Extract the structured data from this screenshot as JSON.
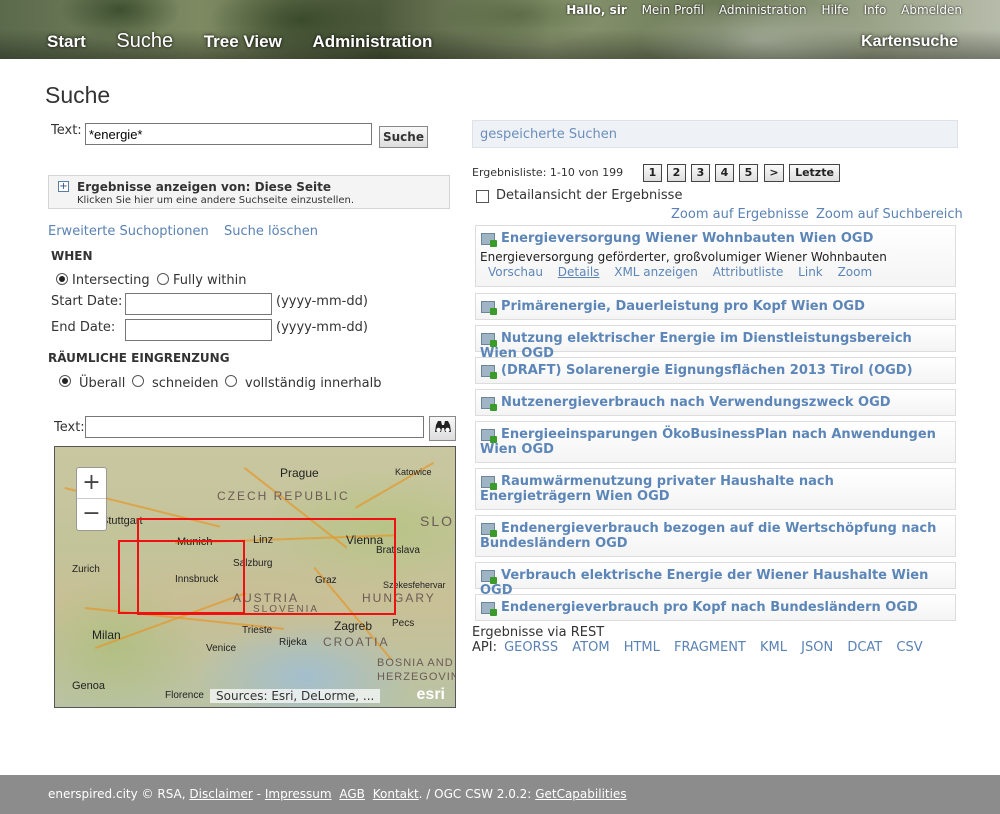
{
  "header": {
    "user": {
      "hello": "Hallo, sir",
      "links": [
        "Mein Profil",
        "Administration",
        "Hilfe",
        "Info",
        "Abmelden"
      ]
    },
    "nav": [
      "Start",
      "Suche",
      "Tree View",
      "Administration"
    ],
    "active_nav": "Suche",
    "right_link": "Kartensuche"
  },
  "page_title": "Suche",
  "search": {
    "text_label": "Text:",
    "text_value": "*energie*",
    "button": "Suche"
  },
  "scope": {
    "toggle_icon": "+",
    "title": "Ergebnisse anzeigen von: Diese Seite",
    "subtitle": "Klicken Sie hier um eine andere Suchseite einzustellen."
  },
  "options": {
    "advanced": "Erweiterte Suchoptionen",
    "clear": "Suche löschen"
  },
  "when": {
    "header": "WHEN",
    "radio_intersecting": "Intersecting",
    "radio_within": "Fully within",
    "start_label": "Start Date:",
    "end_label": "End Date:",
    "format_hint": "(yyyy-mm-dd)"
  },
  "spatial": {
    "header": "RÄUMLICHE EINGRENZUNG",
    "radio_overall": "Überall",
    "radio_intersect": "schneiden",
    "radio_within": "vollständig innerhalb"
  },
  "map": {
    "text_label": "Text:",
    "search_icon": "binoculars-icon",
    "zoom_in": "+",
    "zoom_out": "−",
    "attribution": "Sources: Esri, DeLorme, ...",
    "logo": "esri",
    "cities": [
      "Prague",
      "Munich",
      "Linz",
      "Vienna",
      "Bratislava",
      "Salzburg",
      "Innsbruck",
      "Graz",
      "Zurich",
      "Stuttgart",
      "Zagreb",
      "Milan",
      "Venice",
      "Trieste",
      "Rijeka",
      "Genoa",
      "Florence",
      "Katowice",
      "Szekesfehervar",
      "Pecs"
    ],
    "countries": [
      "CZECH REPUBLIC",
      "AUSTRIA",
      "HUNGARY",
      "SLOVENIA",
      "CROATIA",
      "BOSNIA AND",
      "HERZEGOVINA",
      "SLO"
    ]
  },
  "saved_searches": "gespeicherte Suchen",
  "results_bar": {
    "summary": "Ergebnisliste: 1-10 von 199",
    "pages": [
      "1",
      "2",
      "3",
      "4",
      "5",
      ">",
      "Letzte"
    ],
    "detail_label": "Detailansicht der Ergebnisse",
    "zoom_results": "Zoom auf Ergebnisse",
    "zoom_area": "Zoom auf Suchbereich"
  },
  "results": [
    {
      "title": "Energieversorgung Wiener Wohnbauten Wien OGD",
      "description": "Energieversorgung geförderter, großvolumiger Wiener Wohnbauten",
      "actions": [
        "Vorschau",
        "Details",
        "XML anzeigen",
        "Attributliste",
        "Link",
        "Zoom"
      ]
    },
    {
      "title": "Primärenergie, Dauerleistung pro Kopf Wien OGD"
    },
    {
      "title": "Nutzung elektrischer Energie im Dienstleistungsbereich Wien OGD"
    },
    {
      "title": "(DRAFT) Solarenergie Eignungsflächen 2013 Tirol (OGD)"
    },
    {
      "title": "Nutzenergieverbrauch nach Verwendungszweck OGD"
    },
    {
      "title": "Energieeinsparungen ÖkoBusinessPlan nach Anwendungen Wien OGD"
    },
    {
      "title": "Raumwärmenutzung privater Haushalte nach Energieträgern Wien OGD"
    },
    {
      "title": "Endenergieverbrauch bezogen auf die Wertschöpfung nach Bundesländern OGD"
    },
    {
      "title": "Verbrauch elektrische Energie der Wiener Haushalte Wien OGD"
    },
    {
      "title": "Endenergieverbrauch pro Kopf nach Bundesländern OGD"
    }
  ],
  "api": {
    "line1": "Ergebnisse via REST",
    "label": "API:",
    "formats": [
      "GEORSS",
      "ATOM",
      "HTML",
      "FRAGMENT",
      "KML",
      "JSON",
      "DCAT",
      "CSV"
    ]
  },
  "footer": {
    "prefix": "enerspired.city © RSA,",
    "disclaimer": "Disclaimer",
    "dash": "-",
    "impressum": "Impressum",
    "agb": "AGB",
    "kontakt": "Kontakt",
    "csw": ". / OGC CSW 2.0.2:",
    "getcap": "GetCapabilities"
  }
}
